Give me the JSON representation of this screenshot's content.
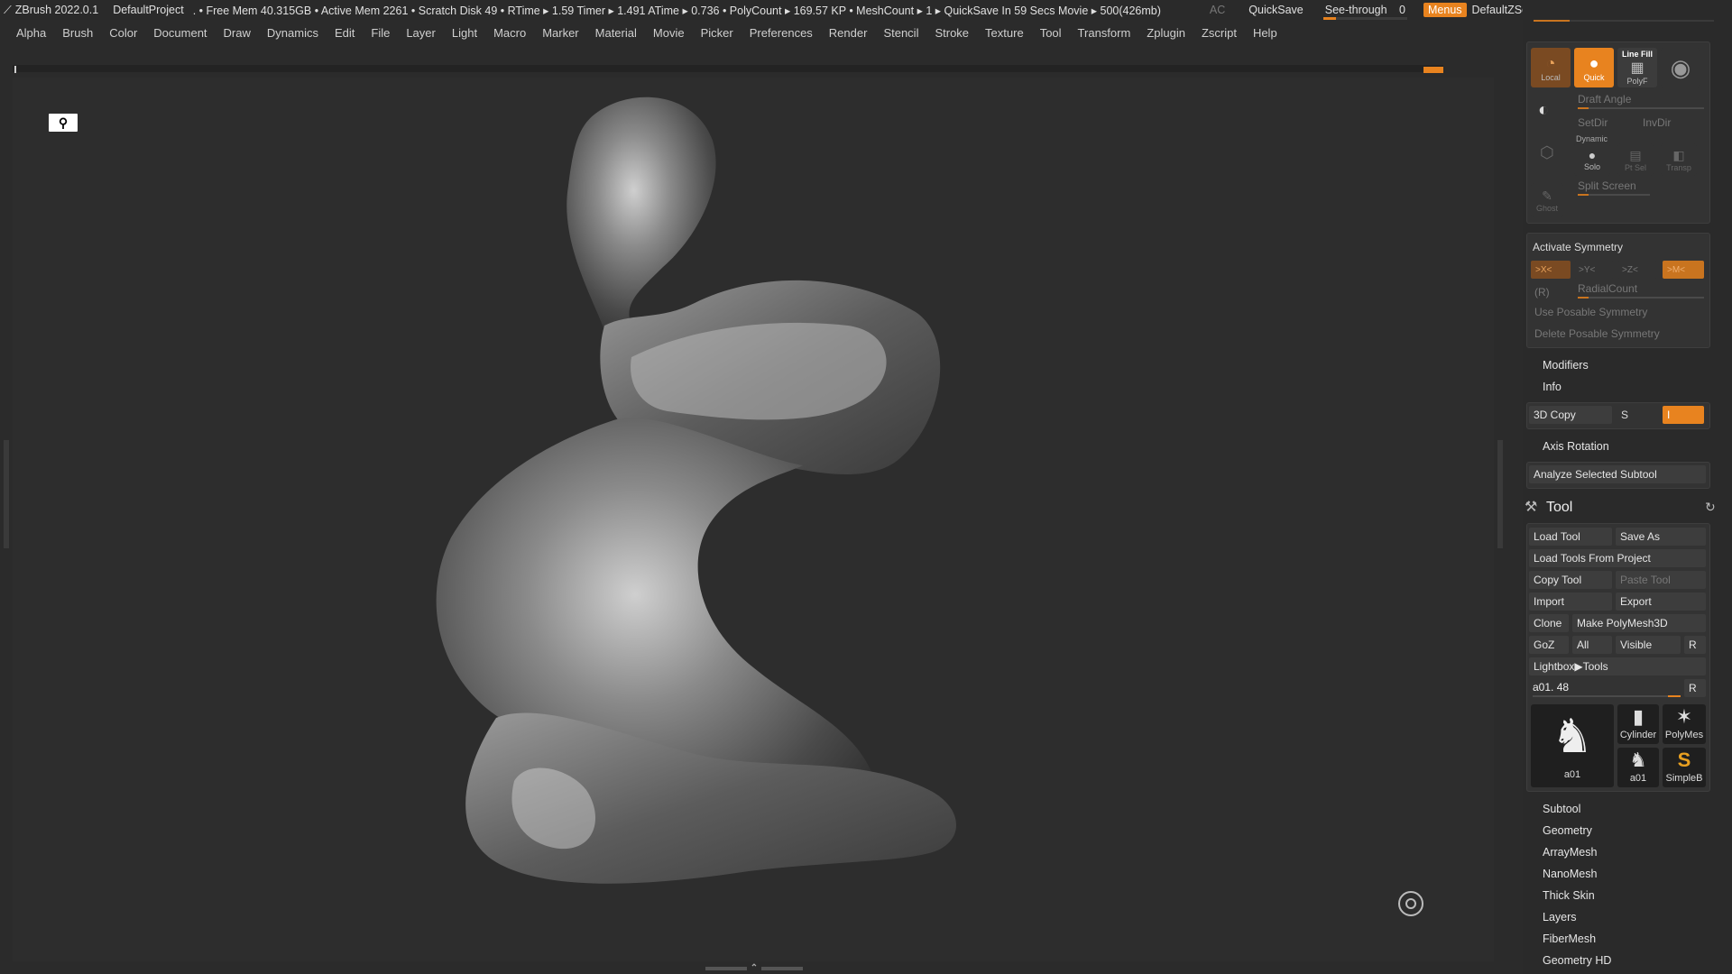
{
  "titlebar": {
    "app": "ZBrush 2022.0.1",
    "project": "DefaultProject",
    "stats": ". • Free Mem 40.315GB • Active Mem 2261 • Scratch Disk 49 •  RTime ▸ 1.59 Timer ▸ 1.491 ATime ▸ 0.736 • PolyCount ▸ 169.57 KP  • MeshCount ▸ 1  ▸ QuickSave In 59 Secs Movie ▸ 500(426mb)",
    "ac": "AC",
    "quicksave": "QuickSave",
    "seethrough": "See-through",
    "seethrough_value": "0",
    "menus": "Menus",
    "zscript": "DefaultZScript"
  },
  "menubar": [
    "Alpha",
    "Brush",
    "Color",
    "Document",
    "Draw",
    "Dynamics",
    "Edit",
    "File",
    "Layer",
    "Light",
    "Macro",
    "Marker",
    "Material",
    "Movie",
    "Picker",
    "Preferences",
    "Render",
    "Stencil",
    "Stroke",
    "Texture",
    "Tool",
    "Transform",
    "Zplugin",
    "Zscript",
    "Help"
  ],
  "panel": {
    "top": {
      "local": "Local",
      "quick": "Quick",
      "line_fill": "Line Fill",
      "polyf": "PolyF",
      "draft_angle": "Draft Angle",
      "setdir": "SetDir",
      "invdir": "InvDir",
      "dynamic": "Dynamic",
      "solo": "Solo",
      "ptsel": "Pt Sel",
      "transp": "Transp",
      "split_screen": "Split Screen",
      "ghost": "Ghost"
    },
    "symmetry": {
      "activate": "Activate Symmetry",
      "x": ">X<",
      "y": ">Y<",
      "z": ">Z<",
      "m": ">M<",
      "r": "(R)",
      "radial": "RadialCount",
      "use_posable": "Use Posable Symmetry",
      "delete_posable": "Delete Posable Symmetry"
    },
    "modifiers": "Modifiers",
    "info": "Info",
    "copy3d": "3D Copy",
    "copy3d_s": "S",
    "copy3d_value": "I",
    "axis_rotation": "Axis Rotation",
    "analyze": "Analyze Selected Subtool",
    "tool": {
      "title": "Tool",
      "load_tool": "Load Tool",
      "save_as": "Save As",
      "load_from_project": "Load Tools From Project",
      "copy_tool": "Copy Tool",
      "paste_tool": "Paste Tool",
      "import": "Import",
      "export": "Export",
      "clone": "Clone",
      "make_polymesh": "Make PolyMesh3D",
      "goz": "GoZ",
      "all": "All",
      "visible": "Visible",
      "r": "R",
      "lightbox": "Lightbox▶Tools",
      "current": "a01. 48",
      "current_r": "R",
      "thumbs": [
        "a01",
        "Cylinder",
        "PolyMes",
        "a01",
        "SimpleB"
      ]
    },
    "sections": [
      "Subtool",
      "Geometry",
      "ArrayMesh",
      "NanoMesh",
      "Thick Skin",
      "Layers",
      "FiberMesh",
      "Geometry HD"
    ]
  }
}
